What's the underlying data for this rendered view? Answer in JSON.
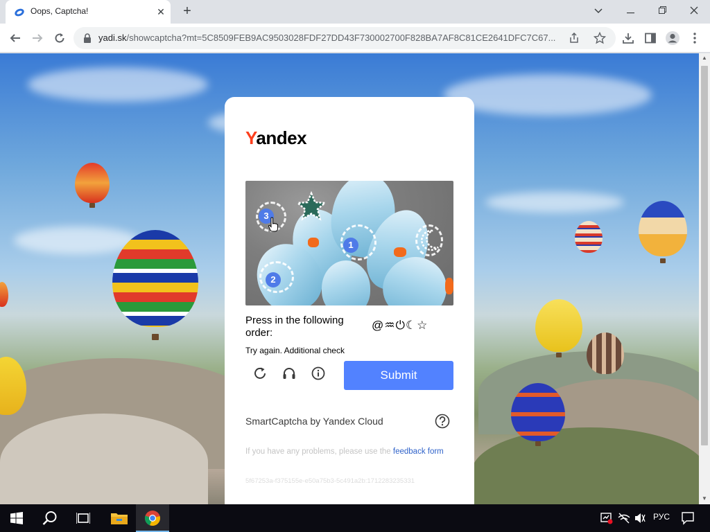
{
  "browser": {
    "tab_title": "Oops, Captcha!",
    "url_host": "yadi.sk",
    "url_path": "/showcaptcha?mt=5C8509FEB9AC9503028FDF27DD43F730002700F828BA7AF8C81CE2641DFC7C67..."
  },
  "captcha": {
    "logo_first": "Y",
    "logo_rest": "andex",
    "markers": [
      "1",
      "2",
      "3"
    ],
    "instruction": "Press in the following order:",
    "order_icons": "@♒⏻☾☆",
    "retry_text": "Try again. Additional check",
    "submit_label": "Submit",
    "brand_text": "SmartCaptcha by Yandex Cloud",
    "feedback_text": "If you have any problems, please use the ",
    "feedback_link": "feedback form",
    "token": "5f67253a-f375155e-e50a75b3-5c491a2b:1712283235331"
  },
  "taskbar": {
    "language": "РУС"
  },
  "colors": {
    "submit": "#5282ff",
    "marker": "#4f7be8",
    "logo_accent": "#fc3f1d"
  }
}
